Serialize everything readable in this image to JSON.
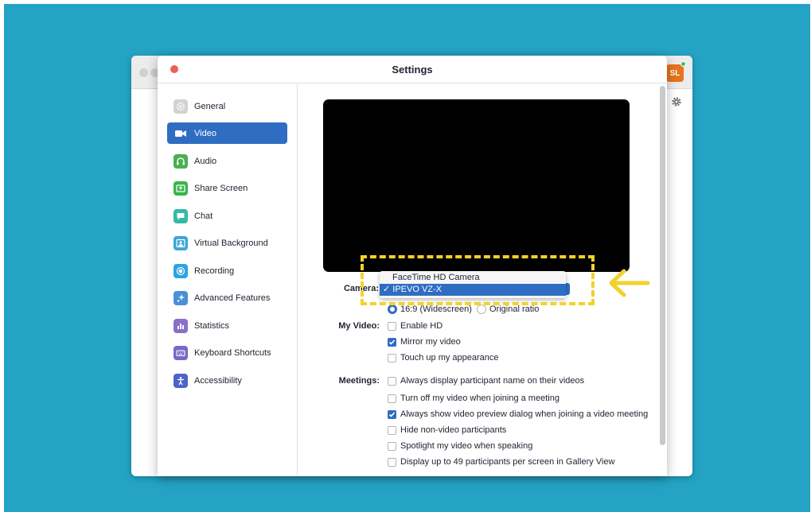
{
  "window": {
    "title": "Settings"
  },
  "background_window": {
    "avatar_initials": "SL"
  },
  "sidebar": {
    "items": [
      {
        "label": "General",
        "icon": "gear-icon",
        "color": "#c4c4c4"
      },
      {
        "label": "Video",
        "icon": "video-camera-icon",
        "color": "#2f6dc2",
        "active": true
      },
      {
        "label": "Audio",
        "icon": "headphones-icon",
        "color": "#4caf50"
      },
      {
        "label": "Share Screen",
        "icon": "share-screen-icon",
        "color": "#39b54a"
      },
      {
        "label": "Chat",
        "icon": "chat-bubble-icon",
        "color": "#34b9a8"
      },
      {
        "label": "Virtual Background",
        "icon": "person-portrait-icon",
        "color": "#3aa6d6"
      },
      {
        "label": "Recording",
        "icon": "record-icon",
        "color": "#2ba4e0"
      },
      {
        "label": "Advanced Features",
        "icon": "sparkle-icon",
        "color": "#4a90d9"
      },
      {
        "label": "Statistics",
        "icon": "bar-chart-icon",
        "color": "#8b6fc8"
      },
      {
        "label": "Keyboard Shortcuts",
        "icon": "keyboard-icon",
        "color": "#7a68c7"
      },
      {
        "label": "Accessibility",
        "icon": "accessibility-icon",
        "color": "#4a64c7"
      }
    ]
  },
  "video": {
    "camera_label": "Camera:",
    "camera_options": [
      "FaceTime HD Camera",
      "IPEVO VZ-X"
    ],
    "camera_selected": "IPEVO VZ-X",
    "aspect": {
      "widescreen": "16:9 (Widescreen)",
      "original": "Original ratio",
      "selected": "widescreen"
    },
    "my_video_label": "My Video:",
    "my_video_options": [
      {
        "label": "Enable HD",
        "checked": false
      },
      {
        "label": "Mirror my video",
        "checked": true
      },
      {
        "label": "Touch up my appearance",
        "checked": false
      }
    ],
    "meetings_label": "Meetings:",
    "meetings_options": [
      {
        "label": "Always display participant name on their videos",
        "checked": false
      },
      {
        "label": "Turn off my video when joining a meeting",
        "checked": false
      },
      {
        "label": "Always show video preview dialog when joining a video meeting",
        "checked": true
      },
      {
        "label": "Hide non-video participants",
        "checked": false
      },
      {
        "label": "Spotlight my video when speaking",
        "checked": false
      },
      {
        "label": "Display up to 49 participants per screen in Gallery View",
        "checked": false
      }
    ]
  },
  "annotation": {
    "highlight_color": "#f3d12b"
  }
}
